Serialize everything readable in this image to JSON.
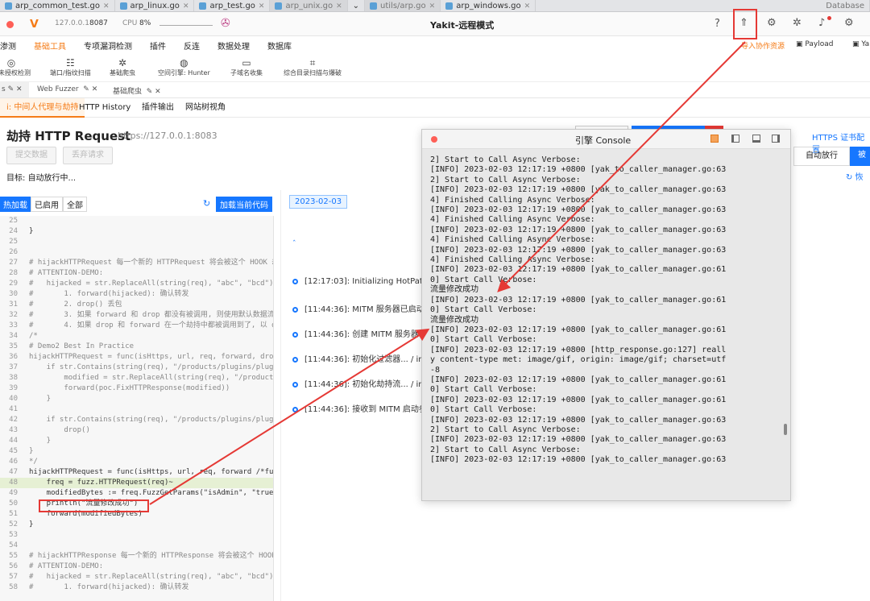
{
  "ide_tabs": [
    {
      "label": "arp_common_test.go",
      "dim": false
    },
    {
      "label": "arp_linux.go",
      "dim": false
    },
    {
      "label": "arp_test.go",
      "dim": false
    },
    {
      "label": "arp_unix.go",
      "dim": true
    },
    {
      "label": "utils/arp.go",
      "dim": true
    },
    {
      "label": "arp_windows.go",
      "dim": false
    }
  ],
  "ide_tabs_extra": "Database",
  "titlebar": {
    "host": "127.0.0.1",
    "port": "8087",
    "cpu_label": "CPU",
    "cpu_value": "8%",
    "title": "Yakit-远程模式"
  },
  "menu1": [
    "渗测",
    "基础工具",
    "专项漏洞检测",
    "插件",
    "反连",
    "数据处理",
    "数据库"
  ],
  "menu1_active": "基础工具",
  "tools": [
    {
      "icon": "target-icon",
      "glyph": "◎",
      "label": "专未授权检测"
    },
    {
      "icon": "fingerprint-icon",
      "glyph": "☷",
      "label": "端口/指纹扫描"
    },
    {
      "icon": "bug-icon",
      "glyph": "✲",
      "label": "基础爬虫"
    },
    {
      "icon": "globe-icon",
      "glyph": "◍",
      "label": "空间引擎: Hunter"
    },
    {
      "icon": "folder-icon",
      "glyph": "▭",
      "label": "子域名收集"
    },
    {
      "icon": "scan-icon",
      "glyph": "⌗",
      "label": "综合目录扫描与爆破"
    }
  ],
  "menu_right": {
    "import_resources": "导入协作资源",
    "payload": "Payload",
    "extra": "Ya"
  },
  "subtabs": {
    "first_truncated": "s",
    "web_fuzzer": "Web Fuzzer",
    "basic_crawler": "基础爬虫"
  },
  "page_tabs": [
    "i: 中间人代理与劫持",
    "HTTP History",
    "插件输出",
    "网站树视角"
  ],
  "hijack": {
    "title": "劫持 HTTP Request",
    "url": "https://127.0.0.1:8083",
    "submit": "提交数据",
    "discard": "丢弃请求",
    "target_label": "目标:",
    "target_value": "自动放行中...",
    "auto_release": "自动放行",
    "hijacked_trunc": "被",
    "https_cert": "HTTPS 证书配置",
    "recover": "恢"
  },
  "hot_tabs": [
    "热加载",
    "已启用",
    "全部"
  ],
  "load_code": "加载当前代码",
  "date_tag": "2023-02-03",
  "code_lines": [
    {
      "n": "25",
      "t": ""
    },
    {
      "n": "24",
      "t": "}"
    },
    {
      "n": "25",
      "t": ""
    },
    {
      "n": "26",
      "t": ""
    },
    {
      "n": "27",
      "t": "# hijackHTTPRequest 每一个新的 HTTPRequest 将会被这个 HOOK 劫",
      "c": 1
    },
    {
      "n": "28",
      "t": "# ATTENTION-DEMO:",
      "c": 1
    },
    {
      "n": "29",
      "t": "#   hijacked = str.ReplaceAll(string(req), \"abc\", \"bcd\")",
      "c": 1
    },
    {
      "n": "30",
      "t": "#       1. forward(hijacked): 确认转发",
      "c": 1
    },
    {
      "n": "31",
      "t": "#       2. drop() 丢包",
      "c": 1
    },
    {
      "n": "32",
      "t": "#       3. 如果 forward 和 drop 都没有被调用, 则使用默认数据流",
      "c": 1
    },
    {
      "n": "33",
      "t": "#       4. 如果 drop 和 forward 在一个劫持中都被调用到了, 以 dr",
      "c": 1
    },
    {
      "n": "34",
      "t": "/*",
      "c": 1
    },
    {
      "n": "35",
      "t": "# Demo2 Best In Practice",
      "c": 1
    },
    {
      "n": "36",
      "t": "hijackHTTPRequest = func(isHttps, url, req, forward, drop",
      "c": 1
    },
    {
      "n": "37",
      "t": "    if str.Contains(string(req), \"/products/plugins/plugi",
      "c": 1
    },
    {
      "n": "38",
      "t": "        modified = str.ReplaceAll(string(req), \"/products",
      "c": 1
    },
    {
      "n": "39",
      "t": "        forward(poc.FixHTTPResponse(modified))",
      "c": 1
    },
    {
      "n": "40",
      "t": "    }",
      "c": 1
    },
    {
      "n": "41",
      "t": "",
      "c": 1
    },
    {
      "n": "42",
      "t": "    if str.Contains(string(req), \"/products/plugins/plugi",
      "c": 1
    },
    {
      "n": "43",
      "t": "        drop()",
      "c": 1
    },
    {
      "n": "44",
      "t": "    }",
      "c": 1
    },
    {
      "n": "45",
      "t": "}",
      "c": 1
    },
    {
      "n": "46",
      "t": "*/",
      "c": 1
    },
    {
      "n": "47",
      "t": "hijackHTTPRequest = func(isHttps, url, req, forward /*fun"
    },
    {
      "n": "48",
      "t": "    freq = fuzz.HTTPRequest(req)~",
      "h": 1
    },
    {
      "n": "49",
      "t": "    modifiedBytes := freq.FuzzGetParams(\"isAdmin\", \"true\""
    },
    {
      "n": "50",
      "t": "    println(\"流量修改成功\")"
    },
    {
      "n": "51",
      "t": "    forward(modifiedBytes)"
    },
    {
      "n": "52",
      "t": "}"
    },
    {
      "n": "53",
      "t": ""
    },
    {
      "n": "54",
      "t": ""
    },
    {
      "n": "55",
      "t": "# hijackHTTPResponse 每一个新的 HTTPResponse 将会被这个 HOOK",
      "c": 1
    },
    {
      "n": "56",
      "t": "# ATTENTION-DEMO:",
      "c": 1
    },
    {
      "n": "57",
      "t": "#   hijacked = str.ReplaceAll(string(req), \"abc\", \"bcd\")",
      "c": 1
    },
    {
      "n": "58",
      "t": "#       1. forward(hijacked): 确认转发",
      "c": 1
    }
  ],
  "log_entries": [
    "[12:17:03]: Initializing HotPatc",
    "[11:44:36]: MITM 服务器已启动",
    "[11:44:36]: 创建 MITM 服务器 /",
    "[11:44:36]: 初始化过滤器... / ini",
    "[11:44:36]: 初始化劫持流... / ini",
    "[11:44:36]: 接收到 MITM 启动参"
  ],
  "console": {
    "title": "引擎 Console",
    "lines": [
      "2] Start to Call Async Verbose:",
      "[INFO] 2023-02-03 12:17:19 +0800 [yak_to_caller_manager.go:63",
      "2] Start to Call Async Verbose:",
      "[INFO] 2023-02-03 12:17:19 +0800 [yak_to_caller_manager.go:63",
      "4] Finished Calling Async Verbose:",
      "[INFO] 2023-02-03 12:17:19 +0800 [yak_to_caller_manager.go:63",
      "4] Finished Calling Async Verbose:",
      "[INFO] 2023-02-03 12:17:19 +0800 [yak_to_caller_manager.go:63",
      "4] Finished Calling Async Verbose:",
      "[INFO] 2023-02-03 12:17:19 +0800 [yak_to_caller_manager.go:63",
      "4] Finished Calling Async Verbose:",
      "[INFO] 2023-02-03 12:17:19 +0800 [yak_to_caller_manager.go:61",
      "0] Start Call Verbose:",
      "流量修改成功",
      "[INFO] 2023-02-03 12:17:19 +0800 [yak_to_caller_manager.go:61",
      "0] Start Call Verbose:",
      "流量修改成功",
      "[INFO] 2023-02-03 12:17:19 +0800 [yak_to_caller_manager.go:61",
      "0] Start Call Verbose:",
      "[INFO] 2023-02-03 12:17:19 +0800 [http_response.go:127] reall",
      "y content-type met: image/gif, origin: image/gif; charset=utf",
      "-8",
      "[INFO] 2023-02-03 12:17:19 +0800 [yak_to_caller_manager.go:61",
      "0] Start Call Verbose:",
      "[INFO] 2023-02-03 12:17:19 +0800 [yak_to_caller_manager.go:61",
      "0] Start Call Verbose:",
      "[INFO] 2023-02-03 12:17:19 +0800 [yak_to_caller_manager.go:63",
      "2] Start to Call Async Verbose:",
      "[INFO] 2023-02-03 12:17:19 +0800 [yak_to_caller_manager.go:63",
      "2] Start to Call Async Verbose:",
      "[INFO] 2023-02-03 12:17:19 +0800 [yak_to_caller_manager.go:63"
    ]
  },
  "colors": {
    "accent": "#1677ff",
    "brand_orange": "#f57c18",
    "annotation_red": "#e53935",
    "comment": "#888888",
    "highlight_line": "#e6f0d4"
  }
}
